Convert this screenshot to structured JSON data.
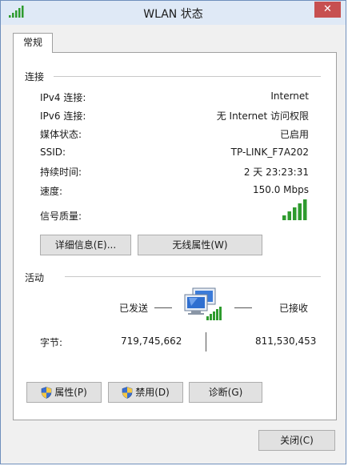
{
  "window": {
    "title": "WLAN 状态",
    "close_label": "✕"
  },
  "tabs": [
    {
      "label": "常规"
    }
  ],
  "connection": {
    "group_label": "连接",
    "rows": [
      {
        "label": "IPv4 连接:",
        "value": "Internet"
      },
      {
        "label": "IPv6 连接:",
        "value": "无 Internet 访问权限"
      },
      {
        "label": "媒体状态:",
        "value": "已启用"
      },
      {
        "label": "SSID:",
        "value": "TP-LINK_F7A202"
      },
      {
        "label": "持续时间:",
        "value": "2 天 23:23:31"
      },
      {
        "label": "速度:",
        "value": "150.0 Mbps"
      }
    ],
    "signal_label": "信号质量:",
    "signal_bars_total": 5,
    "signal_bars_lit": 5,
    "details_button": "详细信息(E)...",
    "wireless_props_button": "无线属性(W)"
  },
  "activity": {
    "group_label": "活动",
    "sent_label": "已发送",
    "received_label": "已接收",
    "bytes_label": "字节:",
    "bytes_sent": "719,745,662",
    "bytes_received": "811,530,453"
  },
  "buttons": {
    "properties": "属性(P)",
    "disable": "禁用(D)",
    "diagnose": "诊断(G)",
    "close": "关闭(C)"
  },
  "colors": {
    "signal_green": "#2e9b2e",
    "title_bar": "#dfe9f6",
    "close_red": "#c75050"
  }
}
